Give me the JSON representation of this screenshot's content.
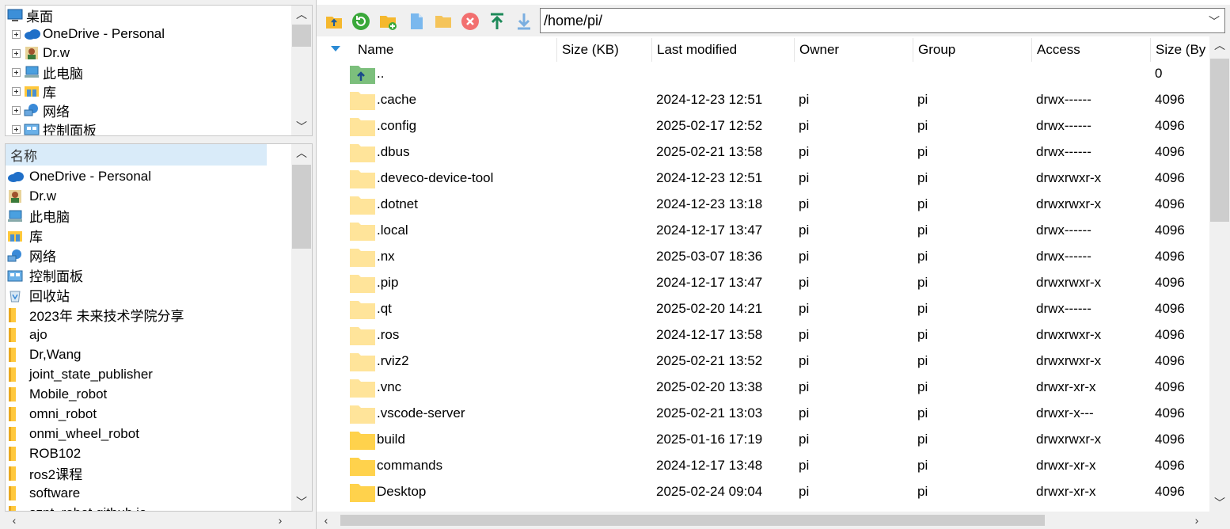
{
  "tree": {
    "root": "桌面",
    "items": [
      "OneDrive - Personal",
      "Dr.w",
      "此电脑",
      "库",
      "网络",
      "控制面板"
    ]
  },
  "list": {
    "header": "名称",
    "items": [
      {
        "label": "OneDrive - Personal",
        "icon": "onedrive-cloud-icon"
      },
      {
        "label": "Dr.w",
        "icon": "user-icon"
      },
      {
        "label": "此电脑",
        "icon": "computer-icon"
      },
      {
        "label": "库",
        "icon": "library-icon"
      },
      {
        "label": "网络",
        "icon": "network-icon"
      },
      {
        "label": "控制面板",
        "icon": "control-panel-icon"
      },
      {
        "label": "回收站",
        "icon": "recycle-bin-icon"
      },
      {
        "label": "2023年 未来技术学院分享",
        "icon": "folder-icon"
      },
      {
        "label": "ajo",
        "icon": "folder-icon"
      },
      {
        "label": "Dr,Wang",
        "icon": "folder-icon"
      },
      {
        "label": "joint_state_publisher",
        "icon": "folder-icon"
      },
      {
        "label": "Mobile_robot",
        "icon": "folder-icon"
      },
      {
        "label": "omni_robot",
        "icon": "folder-icon"
      },
      {
        "label": "onmi_wheel_robot",
        "icon": "folder-icon"
      },
      {
        "label": "ROB102",
        "icon": "folder-icon"
      },
      {
        "label": "ros2课程",
        "icon": "folder-icon"
      },
      {
        "label": "software",
        "icon": "folder-icon"
      },
      {
        "label": "szpt_robot.github.io",
        "icon": "folder-icon"
      }
    ]
  },
  "toolbar": {
    "buttons": [
      "parent-dir-icon",
      "refresh-icon",
      "new-folder-icon",
      "new-file-icon",
      "open-folder-icon",
      "delete-icon",
      "upload-icon",
      "download-icon"
    ],
    "path": "/home/pi/"
  },
  "columns": [
    "Name",
    "Size (KB)",
    "Last modified",
    "Owner",
    "Group",
    "Access",
    "Size (By"
  ],
  "rows": [
    {
      "name": "..",
      "size": "",
      "modified": "",
      "owner": "",
      "group": "",
      "access": "",
      "bytes": "0",
      "type": "parent"
    },
    {
      "name": ".cache",
      "size": "",
      "modified": "2024-12-23 12:51",
      "owner": "pi",
      "group": "pi",
      "access": "drwx------",
      "bytes": "4096",
      "type": "hidden"
    },
    {
      "name": ".config",
      "size": "",
      "modified": "2025-02-17 12:52",
      "owner": "pi",
      "group": "pi",
      "access": "drwx------",
      "bytes": "4096",
      "type": "hidden"
    },
    {
      "name": ".dbus",
      "size": "",
      "modified": "2025-02-21 13:58",
      "owner": "pi",
      "group": "pi",
      "access": "drwx------",
      "bytes": "4096",
      "type": "hidden"
    },
    {
      "name": ".deveco-device-tool",
      "size": "",
      "modified": "2024-12-23 12:51",
      "owner": "pi",
      "group": "pi",
      "access": "drwxrwxr-x",
      "bytes": "4096",
      "type": "hidden"
    },
    {
      "name": ".dotnet",
      "size": "",
      "modified": "2024-12-23 13:18",
      "owner": "pi",
      "group": "pi",
      "access": "drwxrwxr-x",
      "bytes": "4096",
      "type": "hidden"
    },
    {
      "name": ".local",
      "size": "",
      "modified": "2024-12-17 13:47",
      "owner": "pi",
      "group": "pi",
      "access": "drwx------",
      "bytes": "4096",
      "type": "hidden"
    },
    {
      "name": ".nx",
      "size": "",
      "modified": "2025-03-07 18:36",
      "owner": "pi",
      "group": "pi",
      "access": "drwx------",
      "bytes": "4096",
      "type": "hidden"
    },
    {
      "name": ".pip",
      "size": "",
      "modified": "2024-12-17 13:47",
      "owner": "pi",
      "group": "pi",
      "access": "drwxrwxr-x",
      "bytes": "4096",
      "type": "hidden"
    },
    {
      "name": ".qt",
      "size": "",
      "modified": "2025-02-20 14:21",
      "owner": "pi",
      "group": "pi",
      "access": "drwx------",
      "bytes": "4096",
      "type": "hidden"
    },
    {
      "name": ".ros",
      "size": "",
      "modified": "2024-12-17 13:58",
      "owner": "pi",
      "group": "pi",
      "access": "drwxrwxr-x",
      "bytes": "4096",
      "type": "hidden"
    },
    {
      "name": ".rviz2",
      "size": "",
      "modified": "2025-02-21 13:52",
      "owner": "pi",
      "group": "pi",
      "access": "drwxrwxr-x",
      "bytes": "4096",
      "type": "hidden"
    },
    {
      "name": ".vnc",
      "size": "",
      "modified": "2025-02-20 13:38",
      "owner": "pi",
      "group": "pi",
      "access": "drwxr-xr-x",
      "bytes": "4096",
      "type": "hidden"
    },
    {
      "name": ".vscode-server",
      "size": "",
      "modified": "2025-02-21 13:03",
      "owner": "pi",
      "group": "pi",
      "access": "drwxr-x---",
      "bytes": "4096",
      "type": "hidden"
    },
    {
      "name": "build",
      "size": "",
      "modified": "2025-01-16 17:19",
      "owner": "pi",
      "group": "pi",
      "access": "drwxrwxr-x",
      "bytes": "4096",
      "type": "folder"
    },
    {
      "name": "commands",
      "size": "",
      "modified": "2024-12-17 13:48",
      "owner": "pi",
      "group": "pi",
      "access": "drwxr-xr-x",
      "bytes": "4096",
      "type": "folder"
    },
    {
      "name": "Desktop",
      "size": "",
      "modified": "2025-02-24 09:04",
      "owner": "pi",
      "group": "pi",
      "access": "drwxr-xr-x",
      "bytes": "4096",
      "type": "folder"
    }
  ],
  "colors": {
    "accent": "#2a8ad4",
    "folder": "#ffd24c",
    "folder_hidden": "#ffe49a",
    "header_sel": "#d9ebf9"
  }
}
